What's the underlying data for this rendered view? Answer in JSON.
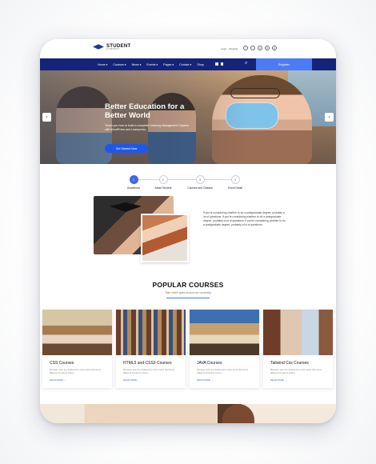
{
  "logo": {
    "name": "STUDENT",
    "tagline": "COMPANY"
  },
  "topbar": {
    "login": "Login",
    "register": "Register",
    "socials": [
      "f",
      "t",
      "p",
      "G",
      "in"
    ]
  },
  "nav": {
    "items": [
      "Home ▾",
      "Courses ▾",
      "News ▾",
      "Events ▾",
      "Pages ▾",
      "Contact ▾",
      "Shop"
    ],
    "search_icon": "⌕",
    "register_label": "Register"
  },
  "hero": {
    "title": "Better Education for a Better World",
    "text": "Teach you how to build a complete Learning Management System with WordPress and Learnpress.",
    "cta": "Get Started Now",
    "prev": "‹",
    "next": "›"
  },
  "steps": [
    {
      "num": "1",
      "label": "Academics"
    },
    {
      "num": "2",
      "label": "About Student"
    },
    {
      "num": "3",
      "label": "Courses and Classes"
    },
    {
      "num": "4",
      "label": "Event Detail"
    }
  ],
  "about": {
    "text": "If you're considering whether to do a postgraduate degree, probably a lot of questions. If you're considering whether to do a postgraduate degree, probably a lot of questions. If you're considering whether to do a postgraduate degree, probably a lot of questions."
  },
  "popular": {
    "title": "POPULAR COURSES",
    "subtitle": "Take which goes around our university"
  },
  "courses": [
    {
      "title": "CSS Courses",
      "desc": "Because web are divided into many parts that serve different functions where...",
      "more": "READ MORE →"
    },
    {
      "title": "HTML5 and CSS3 Courses",
      "desc": "Because web are divided into many parts that serve different functions where...",
      "more": "READ MORE →"
    },
    {
      "title": "JAVA Courses",
      "desc": "Because web are divided into many parts that serve different functions where...",
      "more": "READ MORE →"
    },
    {
      "title": "Tailwind Css Courses",
      "desc": "Because web are divided into many parts that serve different functions where...",
      "more": "READ MORE →"
    }
  ]
}
